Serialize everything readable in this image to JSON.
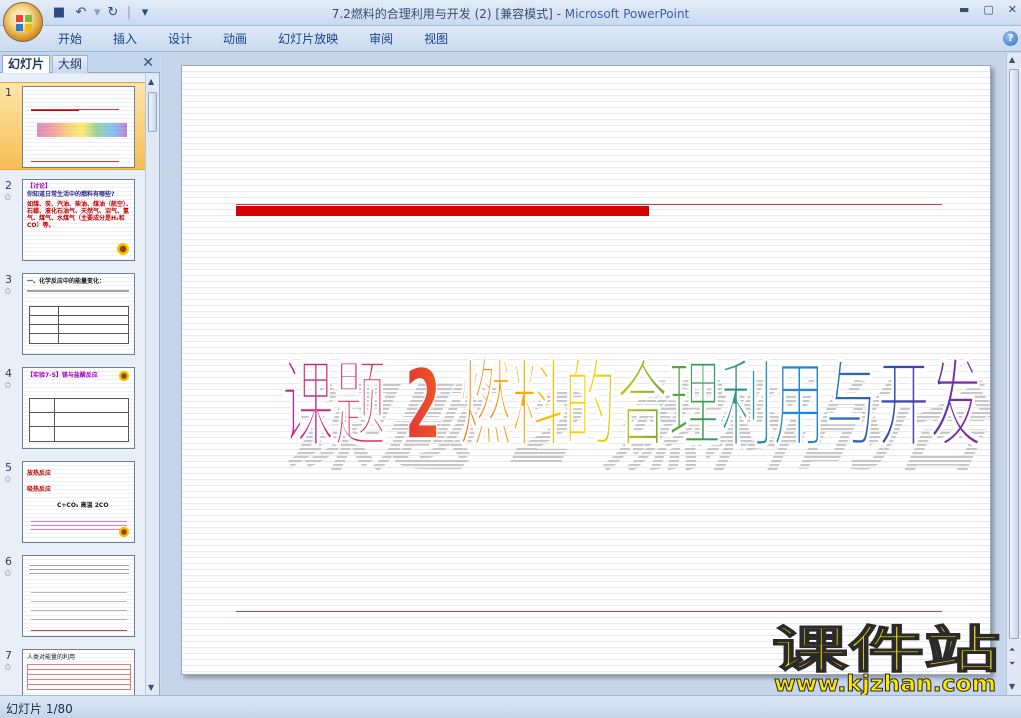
{
  "window": {
    "title": "7.2燃料的合理利用与开发 (2) [兼容模式] - ",
    "app_name": "Microsoft PowerPoint"
  },
  "ribbon": {
    "tabs": [
      "开始",
      "插入",
      "设计",
      "动画",
      "幻灯片放映",
      "审阅",
      "视图"
    ]
  },
  "left_pane": {
    "tab_slides": "幻灯片",
    "tab_outline": "大纲",
    "slides": [
      {
        "num": "1"
      },
      {
        "num": "2",
        "heading": "【讨论】",
        "line1": "你知道日常生活中的燃料有哪些?",
        "body": "如煤、炭、汽油、柴油、煤油（航空）、石蜡、液化石油气、天然气、沼气、氢气、煤气、水煤气（主要成分是H₂和CO）等。"
      },
      {
        "num": "3",
        "heading": "一、化学反应中的能量变化："
      },
      {
        "num": "4",
        "heading": "【实验7-5】镁与盐酸反应"
      },
      {
        "num": "5",
        "line1": "放热反应",
        "line2": "吸热反应",
        "line3": "C+CO₂ 高温 2CO"
      },
      {
        "num": "6"
      },
      {
        "num": "7",
        "heading": "人类对能量的利用"
      }
    ]
  },
  "slide": {
    "title": "课题 2  燃料的合理利用与开发"
  },
  "watermark": {
    "line1": "课件站",
    "line2": "www.kjzhan.com"
  },
  "status": {
    "slide_info": "幻灯片 1/80"
  }
}
